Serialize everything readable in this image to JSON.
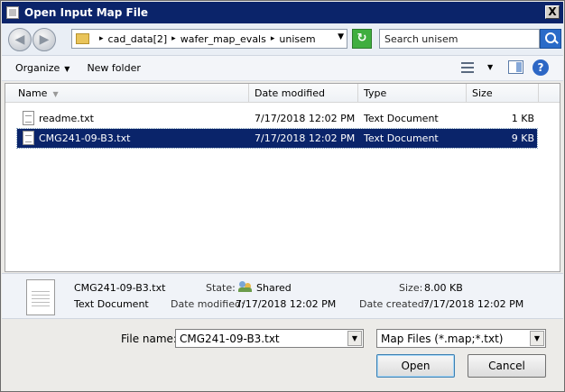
{
  "window": {
    "title": "Open Input Map File",
    "close_glyph": "X"
  },
  "navigation": {
    "back_glyph": "◀",
    "forward_glyph": "▶",
    "breadcrumbs": [
      "cad_data[2]",
      "wafer_map_evals",
      "unisem"
    ],
    "crumb_separator": "▸",
    "refresh_glyph": "↻",
    "search_placeholder": "Search unisem"
  },
  "toolbar": {
    "organize_label": "Organize",
    "new_folder_label": "New folder",
    "help_glyph": "?"
  },
  "columns": {
    "name": "Name",
    "date_modified": "Date modified",
    "type": "Type",
    "size": "Size"
  },
  "files": [
    {
      "name": "readme.txt",
      "date_modified": "7/17/2018 12:02 PM",
      "type": "Text Document",
      "size": "1 KB",
      "selected": false
    },
    {
      "name": "CMG241-09-B3.txt",
      "date_modified": "7/17/2018 12:02 PM",
      "type": "Text Document",
      "size": "9 KB",
      "selected": true
    }
  ],
  "details": {
    "file_name": "CMG241-09-B3.txt",
    "file_type": "Text Document",
    "state_label": "State:",
    "state_value": "Shared",
    "date_modified_label": "Date modified:",
    "date_modified_value": "7/17/2018 12:02 PM",
    "size_label": "Size:",
    "size_value": "8.00 KB",
    "date_created_label": "Date created:",
    "date_created_value": "7/17/2018 12:02 PM"
  },
  "form": {
    "file_name_label": "File name:",
    "file_name_value": "CMG241-09-B3.txt",
    "filter_value": "Map Files (*.map;*.txt)",
    "dropdown_glyph": "▼",
    "open_label": "Open",
    "cancel_label": "Cancel"
  },
  "colors": {
    "title_bar": "#0b246a",
    "selection": "#0a246a"
  }
}
